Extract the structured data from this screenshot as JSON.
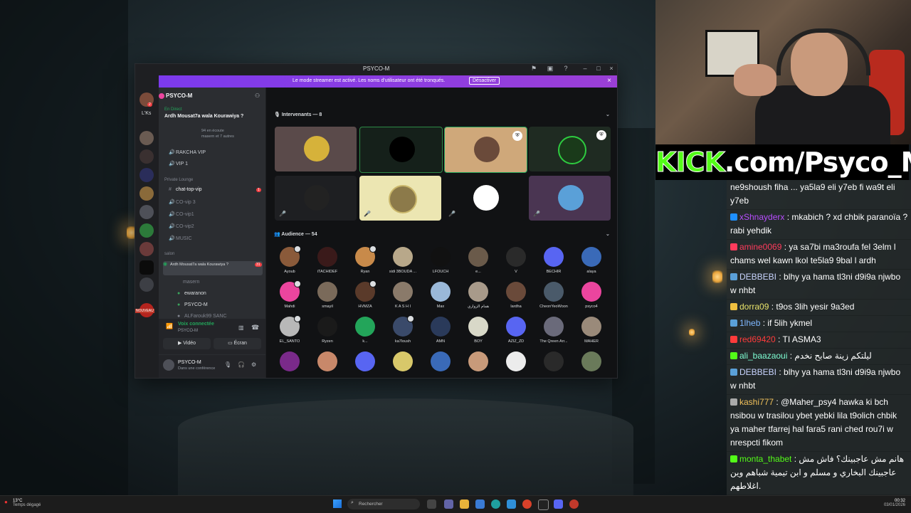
{
  "discord": {
    "window_title": "PSYCO-M",
    "banner": {
      "text": "Le mode streamer est activé. Les noms d'utilisateur ont été tronqués.",
      "button": "Désactiver"
    },
    "server_name": "PSYCO-M",
    "guild_label": "L'Ks",
    "guild_new_badge": "NOUVEAU",
    "live": {
      "status": "En Direct",
      "title": "Ardh Mousat7a wala Kourawiya ?",
      "listeners": "94 en écoute",
      "sub": "masern et 7 autres"
    },
    "channels": [
      {
        "label": "RAKCHA VIP"
      },
      {
        "label": "VIP 1"
      },
      {
        "label": "Private Lounge",
        "category": true
      },
      {
        "label": "chat-top-vip",
        "badge": "1"
      },
      {
        "label": "CO-vip 3"
      },
      {
        "label": "CO-vip1"
      },
      {
        "label": "CO-vip2"
      },
      {
        "label": "MUSIC"
      },
      {
        "label": "salon",
        "category": true
      },
      {
        "label": "Ardh Mousat7a wala Kourawiya ?",
        "badge": "31"
      },
      {
        "label": "masern"
      },
      {
        "label": "ewaranon"
      },
      {
        "label": "PSYCO-M"
      },
      {
        "label": "ALFarouk99 SANC"
      }
    ],
    "voice": {
      "status": "Voix connectée",
      "sub": "PSYCO-M",
      "video_label": "Vidéo",
      "screen_label": "Écran"
    },
    "user": {
      "name": "PSYCO-M",
      "status": "Dans une conférence"
    },
    "speakers_header": "Intervenants — 8",
    "audience_header": "Audience — 54",
    "audience": [
      "Ayoub",
      "iTACHIDEF",
      "Ryan",
      "sidi 3BOUDA ...",
      "LFOUCH",
      "e...",
      "V",
      "BECHIR",
      "alaya",
      "Mahdi",
      "smayil",
      "HVMZA",
      "K A S H I",
      "Max",
      "همام الزواري",
      "lardha",
      "CheonYeoWoon",
      "psyco4",
      "EL_SANTO",
      "Ryzen",
      "k...",
      "ka7loush",
      "AMN",
      "BOY",
      "AZIZ_ZD",
      "The Qreen Arr...",
      "MAHER"
    ]
  },
  "kick_banner": {
    "brand": "KICK",
    "rest": ".com/Psyco_M"
  },
  "chat": [
    {
      "user": "",
      "text": "ne9shoush fiha ... ya5la9 eli y7eb fi wa9t eli y7eb",
      "color": "#ffffff"
    },
    {
      "user": "xShnayderx",
      "text": "mkabich ? xd chbik paranoïa ? rabi yehdik",
      "color": "#b84dff"
    },
    {
      "user": "amine0069",
      "text": "ya sa7bi ma3roufa fel 3elm l chams wel kawn lkol te5la9 9bal l ardh",
      "color": "#ff3b5c"
    },
    {
      "user": "DEBBEBI",
      "text": "blhy ya hama tl3ni d9i9a njwbo w nhbt",
      "color": "#c9d4ff"
    },
    {
      "user": "dorra09",
      "text": "t9os 3lih yesir 9a3ed",
      "color": "#e8e36a"
    },
    {
      "user": "1lheb",
      "text": "if 5lih ykmel",
      "color": "#7fb8ff"
    },
    {
      "user": "red69420",
      "text": "TI ASMA3",
      "color": "#ff3b3b"
    },
    {
      "user": "ali_baazaoui",
      "text": "ليلتكم زينة صابح نخدم",
      "color": "#7fffd4"
    },
    {
      "user": "DEBBEBI",
      "text": "blhy ya hama tl3ni d9i9a njwbo w nhbt",
      "color": "#c9d4ff"
    },
    {
      "user": "kashi777",
      "text": "@Maher_psy4 hawka ki bch nsibou w trasilou ybet yebki lila t9olich chbik ya maher tfarrej hal fara5 rani ched rou7i w nrespcti fikom",
      "color": "#f0c05a"
    },
    {
      "user": "monta_thabet",
      "text": "هانم مش عاجبينك؟ فاش مش عاجبينك البخاري و مسلم و ابن تيمية شباهم وين اغلاطهم.",
      "color": "#53fc18"
    }
  ],
  "taskbar": {
    "weather_temp": "13°C",
    "weather_desc": "Temps dégagé",
    "search_placeholder": "Rechercher",
    "time": "00:32",
    "date": "03/01/2026"
  },
  "colors": {
    "discord_accent": "#5865f2",
    "banner": "#8a2be2",
    "kick_green": "#53fc18"
  }
}
